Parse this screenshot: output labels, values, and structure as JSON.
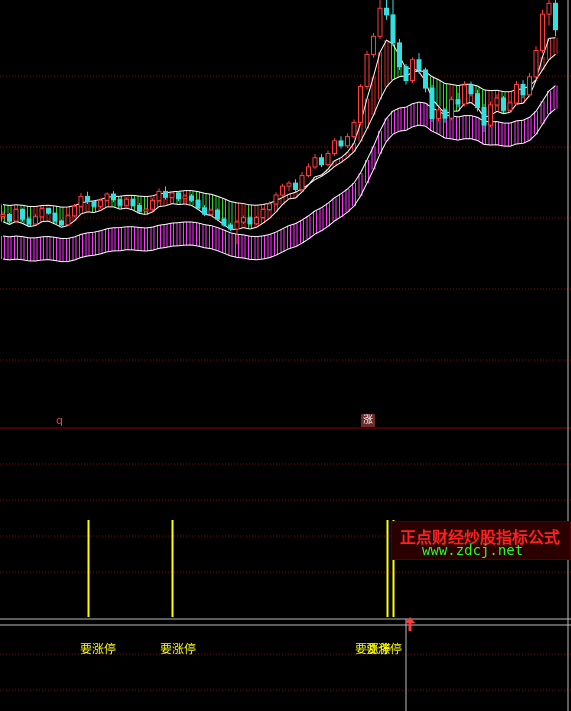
{
  "chart_data": [
    {
      "type": "candlestick",
      "title": "",
      "xlabel": "",
      "ylabel": "",
      "x_axis": "bar index (≈86 daily bars)",
      "y_axis": "price (unlabeled; pane range 0–100 scale)",
      "ylim": [
        0,
        100
      ],
      "series": [
        {
          "name": "",
          "kind": "ohlc",
          "values": [
            [
              34.4,
              35.9,
              33.6,
              35.0
            ],
            [
              35.0,
              35.4,
              32.3,
              33.0
            ],
            [
              33.0,
              37.1,
              32.3,
              36.5
            ],
            [
              36.5,
              36.9,
              32.8,
              33.6
            ],
            [
              33.6,
              34.4,
              31.6,
              32.1
            ],
            [
              32.1,
              35.1,
              31.9,
              34.3
            ],
            [
              34.3,
              37.4,
              33.8,
              36.8
            ],
            [
              36.8,
              37.1,
              35.0,
              35.4
            ],
            [
              35.4,
              35.6,
              32.0,
              33.0
            ],
            [
              33.0,
              33.5,
              31.5,
              31.9
            ],
            [
              31.9,
              35.2,
              31.6,
              34.6
            ],
            [
              34.6,
              38.2,
              34.2,
              37.5
            ],
            [
              37.5,
              41.5,
              37.0,
              40.5
            ],
            [
              40.5,
              41.9,
              38.2,
              38.9
            ],
            [
              38.9,
              39.3,
              36.9,
              37.5
            ],
            [
              37.5,
              39.9,
              36.8,
              39.3
            ],
            [
              39.3,
              41.7,
              38.9,
              41.2
            ],
            [
              41.2,
              42.1,
              38.8,
              39.5
            ],
            [
              39.5,
              40.2,
              37.0,
              37.8
            ],
            [
              37.8,
              40.2,
              37.4,
              39.6
            ],
            [
              39.6,
              39.9,
              37.3,
              37.7
            ],
            [
              37.7,
              38.5,
              35.5,
              36.0
            ],
            [
              36.0,
              37.0,
              34.9,
              36.6
            ],
            [
              36.6,
              39.9,
              36.1,
              39.2
            ],
            [
              39.2,
              42.9,
              38.6,
              42.0
            ],
            [
              42.0,
              43.5,
              39.5,
              40.2
            ],
            [
              40.2,
              42.1,
              39.7,
              41.5
            ],
            [
              41.5,
              42.1,
              39.0,
              39.8
            ],
            [
              39.8,
              41.3,
              37.9,
              40.6
            ],
            [
              40.6,
              41.2,
              38.7,
              39.3
            ],
            [
              39.3,
              39.7,
              36.6,
              37.0
            ],
            [
              37.0,
              37.8,
              34.6,
              35.1
            ],
            [
              35.1,
              36.8,
              34.6,
              36.3
            ],
            [
              36.3,
              36.8,
              33.0,
              33.6
            ],
            [
              33.6,
              34.2,
              31.3,
              31.8
            ],
            [
              31.8,
              32.5,
              30.0,
              30.6
            ],
            [
              30.6,
              33.4,
              26.0,
              32.7
            ],
            [
              32.7,
              34.7,
              32.1,
              34.0
            ],
            [
              34.0,
              34.6,
              31.6,
              32.2
            ],
            [
              32.2,
              34.6,
              31.8,
              34.1
            ],
            [
              34.1,
              37.1,
              33.6,
              36.5
            ],
            [
              36.5,
              39.0,
              36.1,
              38.2
            ],
            [
              38.2,
              41.7,
              37.7,
              40.9
            ],
            [
              40.9,
              44.3,
              40.4,
              43.6
            ],
            [
              43.6,
              45.2,
              42.0,
              44.5
            ],
            [
              44.5,
              45.7,
              41.8,
              42.6
            ],
            [
              42.6,
              47.9,
              42.0,
              46.8
            ],
            [
              46.8,
              50.5,
              46.2,
              49.4
            ],
            [
              49.4,
              53.3,
              48.8,
              52.2
            ],
            [
              52.2,
              53.3,
              49.3,
              50.1
            ],
            [
              50.1,
              54.4,
              49.6,
              53.5
            ],
            [
              53.5,
              58.1,
              52.8,
              57.3
            ],
            [
              57.3,
              58.7,
              55.0,
              55.8
            ],
            [
              55.8,
              59.6,
              55.1,
              58.6
            ],
            [
              58.6,
              63.8,
              58.0,
              62.9
            ],
            [
              62.9,
              74.5,
              62.1,
              73.8
            ],
            [
              73.8,
              84.6,
              72.8,
              83.5
            ],
            [
              83.5,
              90.0,
              82.5,
              89.0
            ],
            [
              89.0,
              100.0,
              88.2,
              97.5
            ],
            [
              97.5,
              100.0,
              94.0,
              95.5
            ],
            [
              95.5,
              100.0,
              86.0,
              87.0
            ],
            [
              87.0,
              88.2,
              78.8,
              79.8
            ],
            [
              79.8,
              80.6,
              74.4,
              75.6
            ],
            [
              75.6,
              82.6,
              74.8,
              81.9
            ],
            [
              81.9,
              83.9,
              77.7,
              78.8
            ],
            [
              78.8,
              79.5,
              72.0,
              73.3
            ],
            [
              73.3,
              74.3,
              63.0,
              64.1
            ],
            [
              64.1,
              67.6,
              63.2,
              66.7
            ],
            [
              66.7,
              67.3,
              62.8,
              64.2
            ],
            [
              64.2,
              70.8,
              63.5,
              69.8
            ],
            [
              69.8,
              71.9,
              67.5,
              68.5
            ],
            [
              68.5,
              75.4,
              67.8,
              74.2
            ],
            [
              74.2,
              75.3,
              70.8,
              71.6
            ],
            [
              71.6,
              72.8,
              66.2,
              67.4
            ],
            [
              67.4,
              68.5,
              60.0,
              62.1
            ],
            [
              62.1,
              69.2,
              61.4,
              68.2
            ],
            [
              68.2,
              71.4,
              67.6,
              70.3
            ],
            [
              70.3,
              70.9,
              65.6,
              66.6
            ],
            [
              66.6,
              69.6,
              66.0,
              68.8
            ],
            [
              68.8,
              75.5,
              68.1,
              74.4
            ],
            [
              74.4,
              75.7,
              70.2,
              71.3
            ],
            [
              71.3,
              77.9,
              70.6,
              76.7
            ],
            [
              76.7,
              86.0,
              75.9,
              84.7
            ],
            [
              84.7,
              97.0,
              83.8,
              95.7
            ],
            [
              95.7,
              100.0,
              92.3,
              99.0
            ],
            [
              99.0,
              100.0,
              89.0,
              91.0
            ]
          ]
        }
      ],
      "colors": {
        "up": "#ff3b3b",
        "down": "#33e0e0",
        "upper_band_falling": "#33ff33",
        "upper_band_rising": "#ff3030",
        "lower_band": "#ff33ff",
        "band_lines": "#ffffff",
        "signal": "#ffff00",
        "grid": "#8b0000"
      },
      "grid": true
    },
    {
      "type": "bar",
      "title": "",
      "xlabel": "",
      "ylabel": "",
      "description": "indicator pane: vertical signal bars at bars 13, 26, 59, 60",
      "signal_bars": [
        13,
        26,
        59,
        60
      ],
      "signal_labels": [
        "要涨停",
        "要涨停",
        "要涨停",
        "要涨停"
      ],
      "top_labels": [
        {
          "text": "q",
          "at_bar": 9
        },
        {
          "text": "涨",
          "at_bar": 60
        }
      ]
    }
  ],
  "watermark": {
    "title": "正点财经炒股指标公式",
    "url": "www.zdcj.net"
  },
  "marker": {
    "icon": "up-arrow-icon",
    "color": "#ff3b3b"
  }
}
